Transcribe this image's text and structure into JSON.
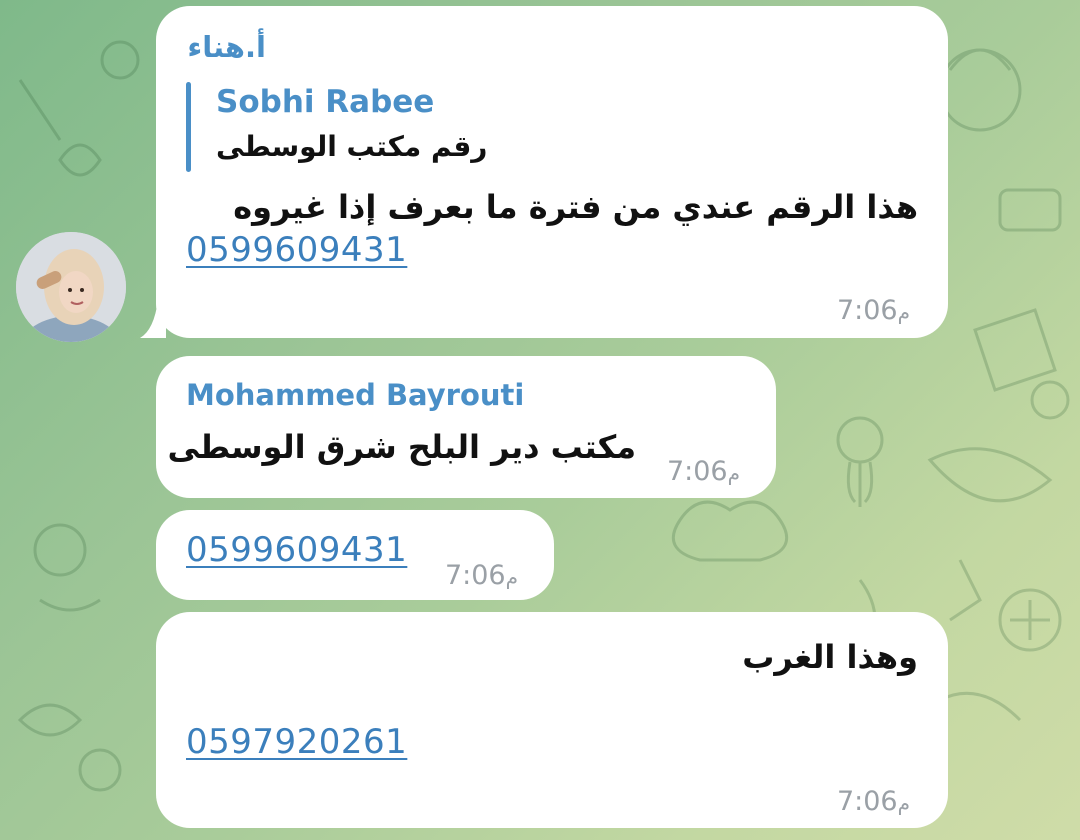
{
  "messages": [
    {
      "sender": "أ.هناء",
      "reply": {
        "name": "Sobhi Rabee",
        "text": "رقم مكتب الوسطى"
      },
      "text": "هذا الرقم عندي من فترة ما بعرف إذا غيروه",
      "phone": "0599609431",
      "time": "7:06",
      "time_suffix": "م"
    },
    {
      "sender": "Mohammed Bayrouti",
      "text": "مكتب دير البلح شرق الوسطى",
      "time": "7:06",
      "time_suffix": "م"
    },
    {
      "phone": "0599609431",
      "time": "7:06",
      "time_suffix": "م"
    },
    {
      "text": "وهذا الغرب",
      "phone": "0597920261",
      "time": "7:06",
      "time_suffix": "م"
    }
  ],
  "avatar": {
    "icon": "user-photo-icon"
  },
  "colors": {
    "sender": "#4a8fc7",
    "link": "#3b7fbc",
    "time": "#9aa0a6",
    "bubble": "#ffffff"
  }
}
